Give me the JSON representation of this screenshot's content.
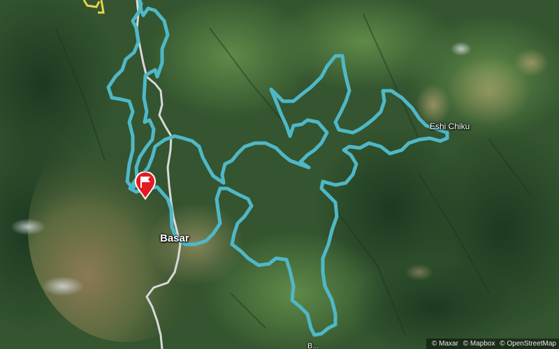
{
  "map": {
    "imagery_type": "satellite",
    "route_color": "#4fb8c8",
    "road_color": "#d9d9d9",
    "place_labels": {
      "basar": "Basar",
      "eshi_chiku": "Eshi Chiku",
      "bottom_partial": "B..."
    },
    "start_marker": {
      "icon": "flag-icon",
      "color": "#e31b23"
    },
    "attribution": {
      "maxar": "© Maxar",
      "mapbox": "© Mapbox",
      "osm": "© OpenStreetMap"
    }
  }
}
